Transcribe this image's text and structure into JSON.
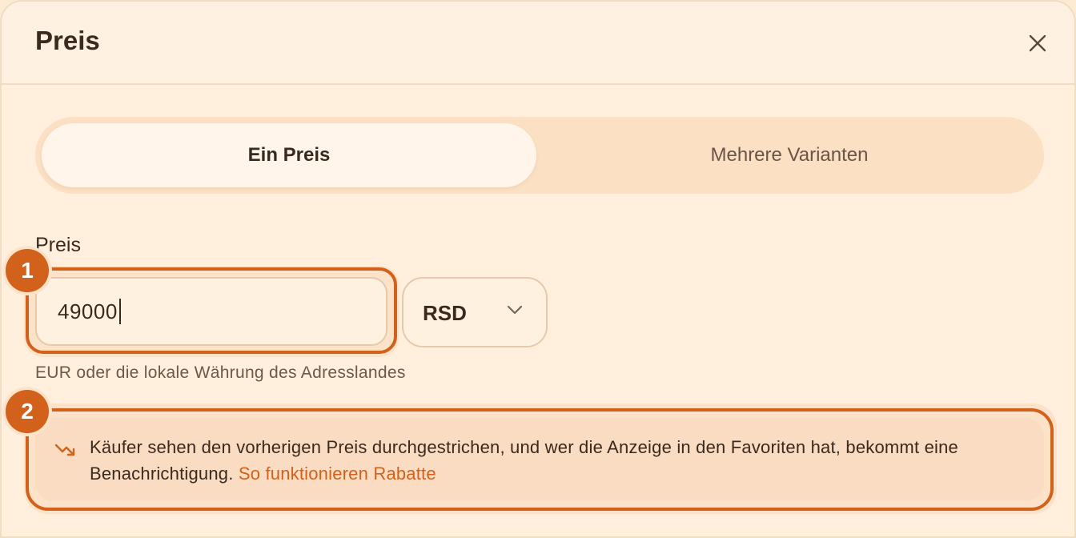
{
  "dialog": {
    "title": "Preis",
    "close_icon": "close-icon"
  },
  "toggle": {
    "options": [
      {
        "label": "Ein Preis",
        "selected": true
      },
      {
        "label": "Mehrere Varianten",
        "selected": false
      }
    ]
  },
  "price": {
    "label": "Preis",
    "value": "49000",
    "currency": "RSD",
    "helper": "EUR oder die lokale Währung des Adresslandes"
  },
  "info": {
    "icon": "trending-down-icon",
    "text": "Käufer sehen den vorherigen Preis durchgestrichen, und wer die Anzeige in den Favoriten hat, bekommt eine Benachrichtigung.",
    "link": "So funktionieren Rabatte"
  },
  "annotations": {
    "badge_1": "1",
    "badge_2": "2"
  },
  "colors": {
    "accent": "#d2611b",
    "background": "#ffefdc"
  }
}
